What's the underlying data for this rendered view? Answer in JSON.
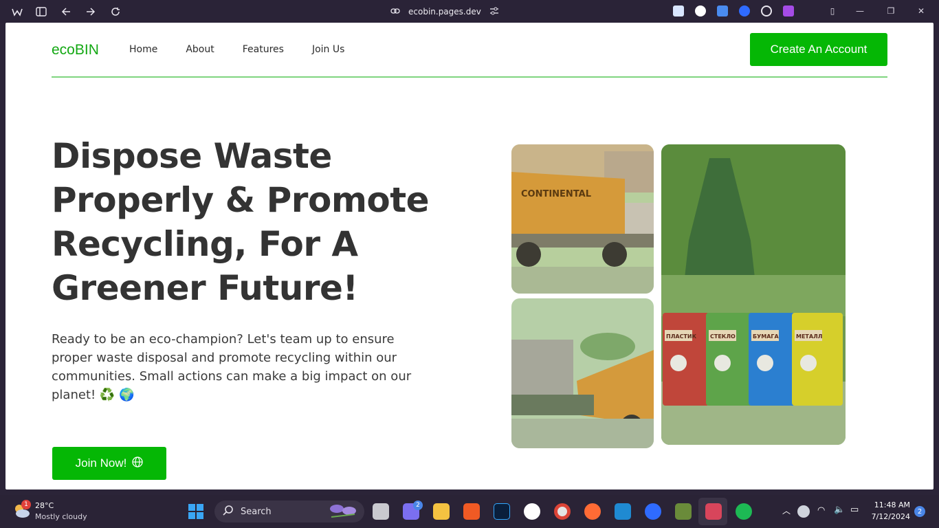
{
  "browser": {
    "url": "ecobin.pages.dev"
  },
  "site": {
    "logo": "ecoBIN",
    "nav": [
      "Home",
      "About",
      "Features",
      "Join Us"
    ],
    "cta": "Create An Account",
    "hero_title": "Dispose Waste Properly & Promote Recycling, For A Greener Future!",
    "hero_text": "Ready to be an eco-champion? Let's team up to ensure proper waste disposal and promote recycling within our communities. Small actions can make a big impact on our planet! ♻️ 🌍",
    "join_label": "Join Now!",
    "truck_label": "CONTINENTAL",
    "bin_labels": [
      "ПЛАСТИК",
      "СТЕКЛО",
      "БУМАГА",
      "МЕТАЛЛ"
    ]
  },
  "taskbar": {
    "weather_temp": "28°C",
    "weather_desc": "Mostly cloudy",
    "weather_badge": "1",
    "search_label": "Search",
    "meet_badge": "2",
    "time": "11:48 AM",
    "date": "7/12/2024",
    "notif_count": "2"
  },
  "colors": {
    "brand_green": "#05b705",
    "logo_green": "#13a813",
    "divider": "#7ed47f"
  }
}
